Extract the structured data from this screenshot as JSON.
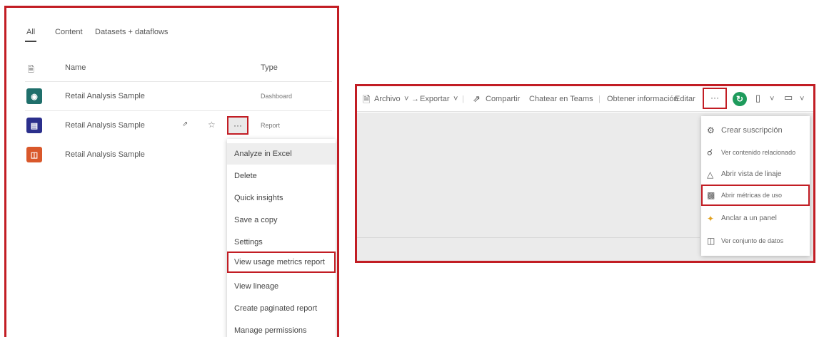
{
  "left": {
    "tabs": [
      "All",
      "Content",
      "Datasets + dataflows"
    ],
    "headers": {
      "name": "Name",
      "type": "Type"
    },
    "rows": [
      {
        "name": "Retail Analysis Sample",
        "type": "Dashboard",
        "icon": "dashboard-icon",
        "color": "#1f6f6b"
      },
      {
        "name": "Retail Analysis Sample",
        "type": "Report",
        "icon": "report-icon",
        "color": "#2b2f8c"
      },
      {
        "name": "Retail Analysis Sample",
        "type": "",
        "icon": "dataset-icon",
        "color": "#d9582b"
      }
    ],
    "more_button": "···",
    "menu": [
      "Analyze in Excel",
      "Delete",
      "Quick insights",
      "Save a copy",
      "Settings",
      "View usage metrics report",
      "View lineage",
      "Create paginated report",
      "Manage permissions"
    ]
  },
  "right": {
    "toolbar": {
      "archivo": "Archivo",
      "exportar": "Exportar",
      "compartir": "Compartir",
      "chatear": "Chatear en Teams",
      "obtener": "Obtener información",
      "editar": "Editar",
      "dots": "···"
    },
    "menu": [
      {
        "label": "Crear suscripción",
        "icon": "subscription-icon"
      },
      {
        "label": "Ver contenido relacionado",
        "icon": "related-content-icon"
      },
      {
        "label": "Abrir vista de linaje",
        "icon": "lineage-icon"
      },
      {
        "label": "Abrir métricas de uso",
        "icon": "usage-metrics-icon"
      },
      {
        "label": "Anclar a un panel",
        "icon": "pin-icon"
      },
      {
        "label": "Ver conjunto de datos",
        "icon": "dataset-icon"
      }
    ]
  },
  "colors": {
    "highlight_border": "#c21d24",
    "refresh": "#1e9b5c"
  }
}
